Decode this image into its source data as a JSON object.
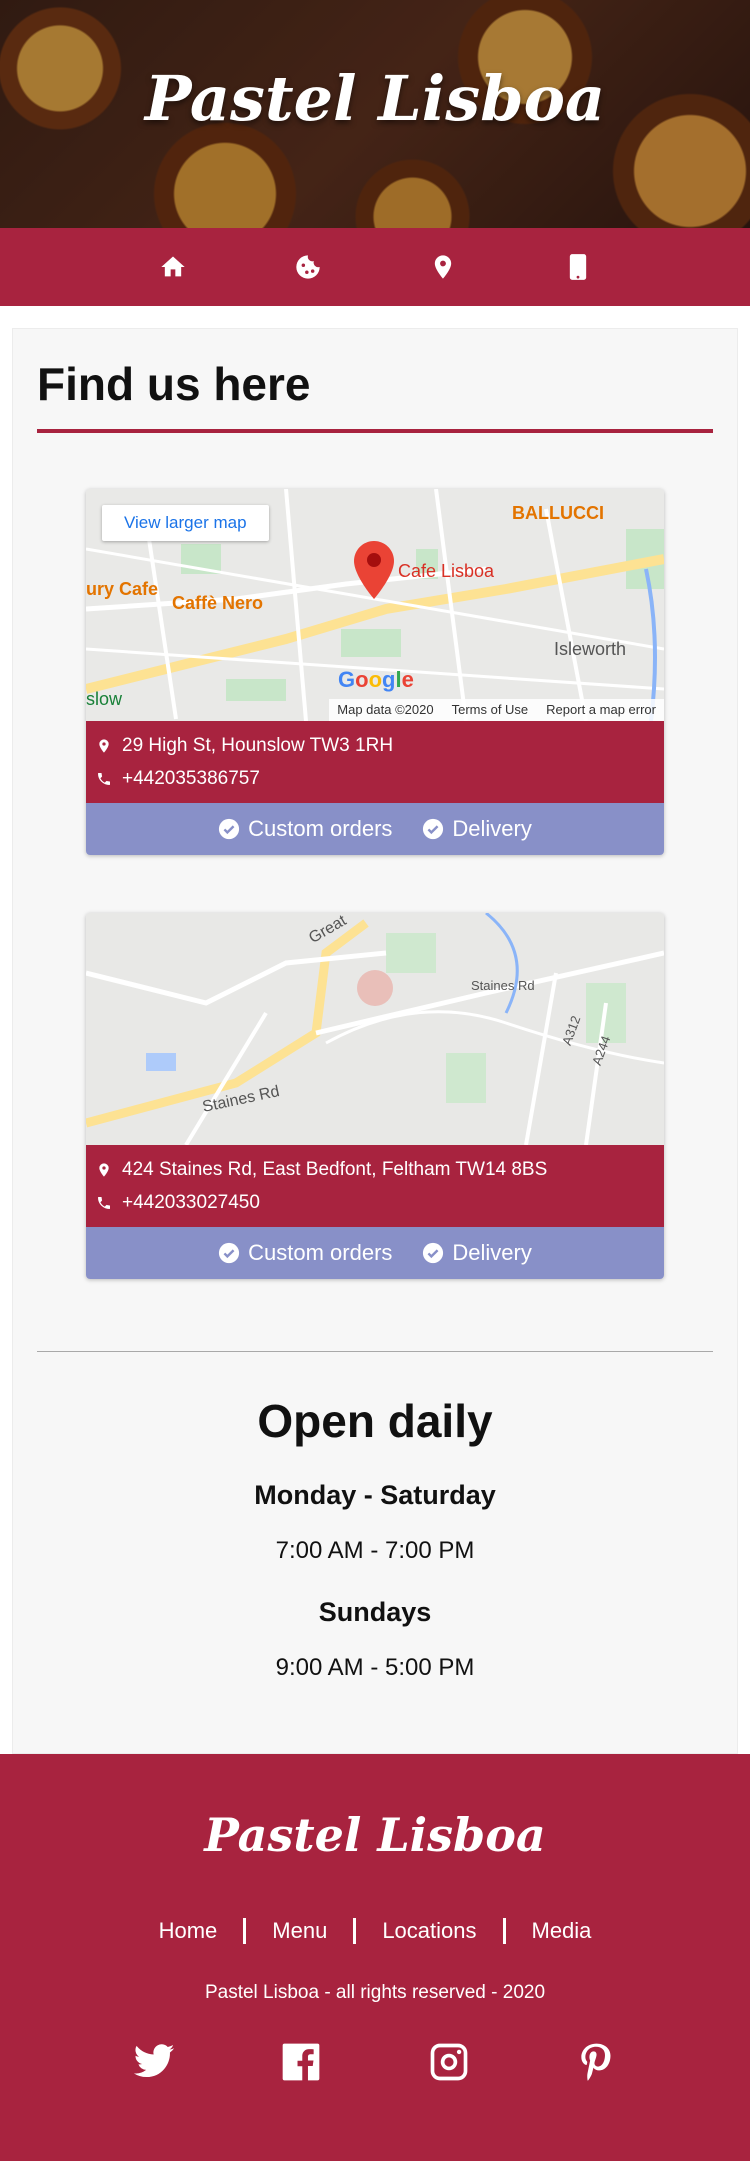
{
  "site": {
    "brand": "Pastel Lisboa"
  },
  "nav": {
    "items": [
      {
        "icon": "home-icon"
      },
      {
        "icon": "cookie-icon"
      },
      {
        "icon": "location-pin-icon"
      },
      {
        "icon": "mobile-phone-icon"
      }
    ]
  },
  "page": {
    "title": "Find us here"
  },
  "locations": [
    {
      "address": "29 High St, Hounslow TW3 1RH",
      "phone": "+442035386757",
      "features": [
        "Custom orders",
        "Delivery"
      ],
      "map": {
        "button": "View larger map",
        "marker_label": "Cafe Lisboa",
        "places": [
          "BALLUCCI",
          "Caffè Nero",
          "ury Cafe",
          "Isleworth",
          "slow"
        ],
        "logo": "Google",
        "footer": [
          "Map data ©2020",
          "Terms of Use",
          "Report a map error"
        ]
      }
    },
    {
      "address": "424 Staines Rd, East Bedfont, Feltham TW14 8BS",
      "phone": "+442033027450",
      "features": [
        "Custom orders",
        "Delivery"
      ],
      "map": {
        "roads": [
          "Staines Rd",
          "Staines Rd",
          "Great",
          "A312",
          "A244"
        ]
      }
    }
  ],
  "hours": {
    "title": "Open daily",
    "weekday_label": "Monday - Saturday",
    "weekday_time": "7:00 AM - 7:00 PM",
    "sunday_label": "Sundays",
    "sunday_time": "9:00 AM - 5:00 PM"
  },
  "footer": {
    "brand": "Pastel Lisboa",
    "links": [
      "Home",
      "Menu",
      "Locations",
      "Media"
    ],
    "copyright": "Pastel Lisboa - all rights reserved - 2020",
    "socials": [
      "twitter-icon",
      "facebook-icon",
      "instagram-icon",
      "pinterest-icon"
    ]
  },
  "colors": {
    "primary": "#a8233f",
    "features_bar": "#8890c8",
    "map_link": "#1a73e8"
  }
}
